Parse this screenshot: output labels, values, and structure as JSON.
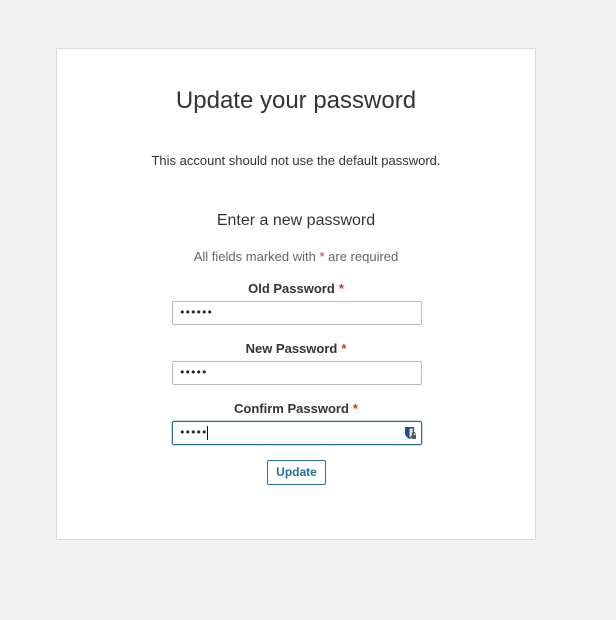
{
  "page": {
    "title": "Update your password",
    "notice": "This account should not use the default password.",
    "subtitle": "Enter a new password",
    "required_note_prefix": "All fields marked with ",
    "required_star": "*",
    "required_note_suffix": " are required"
  },
  "fields": [
    {
      "label": "Old Password",
      "required_mark": "*",
      "value": "••••••"
    },
    {
      "label": "New Password",
      "required_mark": "*",
      "value": "•••••"
    },
    {
      "label": "Confirm Password",
      "required_mark": "*",
      "value": "•••••",
      "has_password_manager_icon": true,
      "focused": true
    }
  ],
  "buttons": {
    "update_label": "Update"
  },
  "colors": {
    "accent": "#2c6e8f",
    "required": "#c0392b",
    "background": "#f1f1f1",
    "card": "#ffffff"
  },
  "icons": {
    "password_manager": "password-manager-shield-icon"
  }
}
